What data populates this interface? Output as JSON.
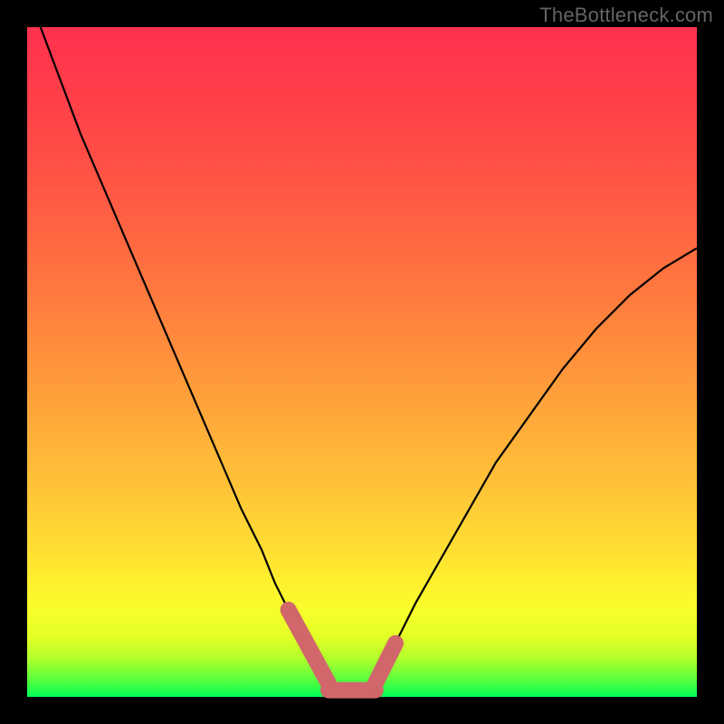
{
  "watermark": "TheBottleneck.com",
  "chart_data": {
    "type": "line",
    "title": "",
    "xlabel": "",
    "ylabel": "",
    "xlim": [
      0,
      100
    ],
    "ylim": [
      0,
      100
    ],
    "series": [
      {
        "name": "bottleneck-curve",
        "x": [
          2,
          5,
          8,
          11,
          14,
          17,
          20,
          23,
          26,
          29,
          32,
          35,
          37,
          39,
          41,
          43,
          44,
          45,
          47,
          50,
          52,
          53,
          55,
          58,
          62,
          66,
          70,
          75,
          80,
          85,
          90,
          95,
          100
        ],
        "y": [
          100,
          92,
          84,
          77,
          70,
          63,
          56,
          49,
          42,
          35,
          28,
          22,
          17,
          13,
          9,
          6,
          4,
          2,
          1,
          1,
          2,
          4,
          8,
          14,
          21,
          28,
          35,
          42,
          49,
          55,
          60,
          64,
          67
        ]
      }
    ],
    "highlight_zone": {
      "name": "optimal-range",
      "color": "#d1676a",
      "segments": [
        {
          "x": [
            39,
            45
          ],
          "y": [
            13,
            2
          ]
        },
        {
          "x": [
            45,
            52
          ],
          "y": [
            1,
            1
          ]
        },
        {
          "x": [
            52,
            55
          ],
          "y": [
            2,
            8
          ]
        }
      ]
    },
    "gradient_stops": [
      {
        "pos": 0,
        "color": "#00ff55"
      },
      {
        "pos": 13,
        "color": "#f8fd2b"
      },
      {
        "pos": 50,
        "color": "#ff953b"
      },
      {
        "pos": 100,
        "color": "#ff314e"
      }
    ]
  }
}
